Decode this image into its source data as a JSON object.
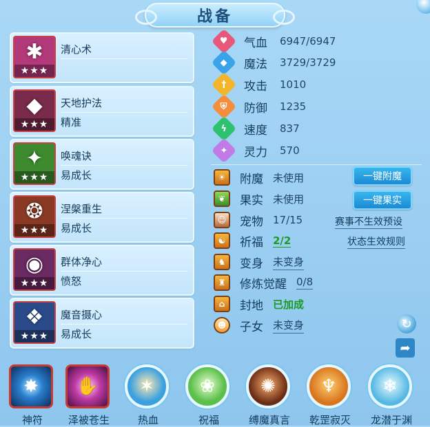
{
  "title": "战备",
  "skills": [
    {
      "name": "清心术",
      "sub": "",
      "stars": "★★★",
      "icon": "popsicle-skill-icon",
      "color": "#b23a7a",
      "glyph": "✱"
    },
    {
      "name": "天地护法",
      "sub": "精准",
      "stars": "★★★",
      "icon": "guardian-skill-icon",
      "color": "#7a2a4a",
      "glyph": "◆"
    },
    {
      "name": "唤魂诀",
      "sub": "易成长",
      "stars": "★★★",
      "icon": "soul-summon-skill-icon",
      "color": "#3e8a2e",
      "glyph": "✦"
    },
    {
      "name": "涅槃重生",
      "sub": "易成长",
      "stars": "★★★",
      "icon": "phoenix-rebirth-skill-icon",
      "color": "#8a3a24",
      "glyph": "❂"
    },
    {
      "name": "群体净心",
      "sub": "愤怒",
      "stars": "★★★",
      "icon": "group-purify-skill-icon",
      "color": "#6a2a62",
      "glyph": "◉"
    },
    {
      "name": "魔音摄心",
      "sub": "易成长",
      "stars": "★★★",
      "icon": "demon-sound-skill-icon",
      "color": "#2a4a8a",
      "glyph": "❖"
    }
  ],
  "stats": [
    {
      "label": "气血",
      "value": "6947/6947",
      "color": "#e8587a",
      "icon": "heart-icon",
      "glyph": "♥"
    },
    {
      "label": "魔法",
      "value": "3729/3729",
      "color": "#3aa3ea",
      "icon": "mana-icon",
      "glyph": "◆"
    },
    {
      "label": "攻击",
      "value": "1010",
      "color": "#f3b52c",
      "icon": "attack-icon",
      "glyph": "†"
    },
    {
      "label": "防御",
      "value": "1235",
      "color": "#f48d3c",
      "icon": "defense-icon",
      "glyph": "⛨"
    },
    {
      "label": "速度",
      "value": "837",
      "color": "#2fc26e",
      "icon": "speed-icon",
      "glyph": "ϟ"
    },
    {
      "label": "灵力",
      "value": "570",
      "color": "#c17ae6",
      "icon": "spirit-icon",
      "glyph": "✦"
    }
  ],
  "extras": [
    {
      "label": "附魔",
      "value": "未使用",
      "style": "plain",
      "icon": "enchant-icon",
      "iconStyle": "",
      "glyph": "☀"
    },
    {
      "label": "果实",
      "value": "未使用",
      "style": "plain",
      "icon": "fruit-icon",
      "iconStyle": "green",
      "glyph": "❦"
    },
    {
      "label": "宠物",
      "value": "17/15",
      "style": "plain",
      "icon": "pet-icon",
      "iconStyle": "pet",
      "glyph": "☺"
    },
    {
      "label": "祈福",
      "value": "2/2",
      "style": "green",
      "icon": "blessing-icon",
      "iconStyle": "",
      "glyph": "☯"
    },
    {
      "label": "变身",
      "value": "未变身",
      "style": "u",
      "icon": "transform-icon",
      "iconStyle": "",
      "glyph": "♞"
    },
    {
      "label": "修炼觉醒",
      "value": "0/8",
      "style": "u",
      "icon": "cultivation-icon",
      "iconStyle": "",
      "glyph": "♜"
    },
    {
      "label": "封地",
      "value": "已加成",
      "style": "green2",
      "icon": "fief-icon",
      "iconStyle": "",
      "glyph": "⌂"
    },
    {
      "label": "子女",
      "value": "未变身",
      "style": "u",
      "icon": "child-icon",
      "iconStyle": "round",
      "glyph": "☻"
    }
  ],
  "buttons": {
    "enchant": "一键附魔",
    "fruit": "一键果实"
  },
  "links": {
    "event_preset": "赛事不生效预设",
    "state_rules": "状态生效规则"
  },
  "bottom": [
    {
      "label": "神符",
      "shape": "square",
      "icon": "rune-icon",
      "bg": "radial-gradient(circle at 50% 50%, #bff0ff, #2a7fd0 40%, #0d2e5c)",
      "glyph": "✸"
    },
    {
      "label": "泽被苍生",
      "shape": "square",
      "icon": "blessing-hand-icon",
      "bg": "radial-gradient(circle at 50% 50%, #ffd2ff, #c03aa5 45%, #4a1040)",
      "glyph": "✋"
    },
    {
      "label": "热血",
      "shape": "circle",
      "icon": "hot-blood-icon",
      "bg": "radial-gradient(circle at 50% 45%, #ffe9b0, #3aa0e0 60%)",
      "glyph": "✶"
    },
    {
      "label": "祝福",
      "shape": "circle",
      "icon": "wish-icon",
      "bg": "radial-gradient(circle at 50% 45%, #e9ffd0, #5bbf4a 60%)",
      "glyph": "❀"
    },
    {
      "label": "缚魔真言",
      "shape": "circle",
      "icon": "bind-demon-icon",
      "bg": "radial-gradient(circle at 50% 45%, #ffb070, #6a2c14 65%)",
      "glyph": "✺"
    },
    {
      "label": "乾罡寂灭",
      "shape": "circle",
      "icon": "annihilate-icon",
      "bg": "radial-gradient(circle at 50% 45%, #ffd070, #d8741c 65%)",
      "glyph": "♆"
    },
    {
      "label": "龙潜于渊",
      "shape": "circle",
      "icon": "dragon-abyss-icon",
      "bg": "radial-gradient(circle at 50% 45%, #e9fbff, #54b7e4 65%)",
      "glyph": "❄"
    }
  ]
}
